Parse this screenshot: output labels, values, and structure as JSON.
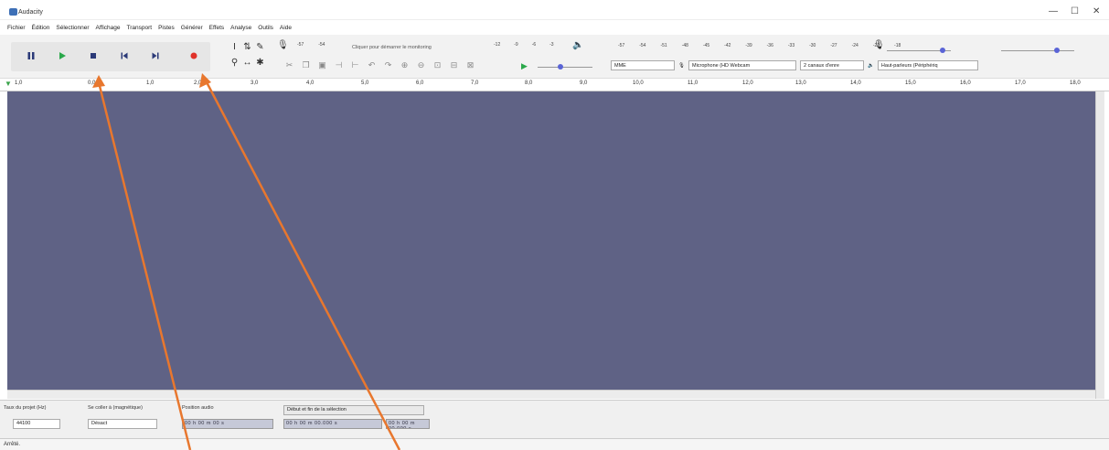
{
  "window": {
    "title": "Audacity",
    "controls": {
      "minimize": "—",
      "maximize": "☐",
      "close": "✕"
    }
  },
  "menu": [
    "Fichier",
    "Édition",
    "Sélectionner",
    "Affichage",
    "Transport",
    "Pistes",
    "Générer",
    "Effets",
    "Analyse",
    "Outils",
    "Aide"
  ],
  "transport": {
    "buttons": [
      "pause",
      "play",
      "stop",
      "skip-to-start",
      "skip-to-end",
      "record"
    ]
  },
  "meters": {
    "record_hint": "Cliquer pour démarrer le monitoring",
    "record_scale": [
      "-57",
      "-54",
      "-51",
      "-48",
      "-45",
      "-42"
    ],
    "playback_scale": [
      "-18",
      "-15",
      "-12",
      "-9",
      "-6",
      "-3",
      "0"
    ],
    "output_scale": [
      "-57",
      "-54",
      "-51",
      "-48",
      "-45",
      "-42",
      "-39",
      "-36",
      "-33",
      "-30",
      "-27",
      "-24",
      "-21",
      "-18",
      "-15",
      "-12",
      "-9",
      "-6",
      "-3",
      "0"
    ]
  },
  "devices": {
    "host": "MME",
    "microphone": "Microphone (HD Webcam",
    "channels": "2 canaux d'enre",
    "speakers": "Haut-parleurs (Périphériq"
  },
  "ruler": [
    "1,0",
    "0,0",
    "1,0",
    "2,0",
    "3,0",
    "4,0",
    "5,0",
    "6,0",
    "7,0",
    "8,0",
    "9,0",
    "10,0",
    "11,0",
    "12,0",
    "13,0",
    "14,0",
    "15,0",
    "16,0",
    "17,0",
    "18,0"
  ],
  "selection_bar": {
    "rate_label": "Taux du projet (Hz)",
    "rate_value": "44100",
    "snap_label": "Se coller à (magnétique)",
    "snap_value": "Désact",
    "position_label": "Position audio",
    "position_value": "00 h 00 m 00 s",
    "selection_label": "Début et fin de la sélection",
    "sel_start": "00 h 00 m 00.000 s",
    "sel_end": "00 h 00 m 00.000 s"
  },
  "status": {
    "text": "Arrêté."
  },
  "colors": {
    "track_bg": "#5f6285",
    "record": "#e0322a",
    "play": "#2aa84a",
    "annotation": "#e8772e"
  }
}
